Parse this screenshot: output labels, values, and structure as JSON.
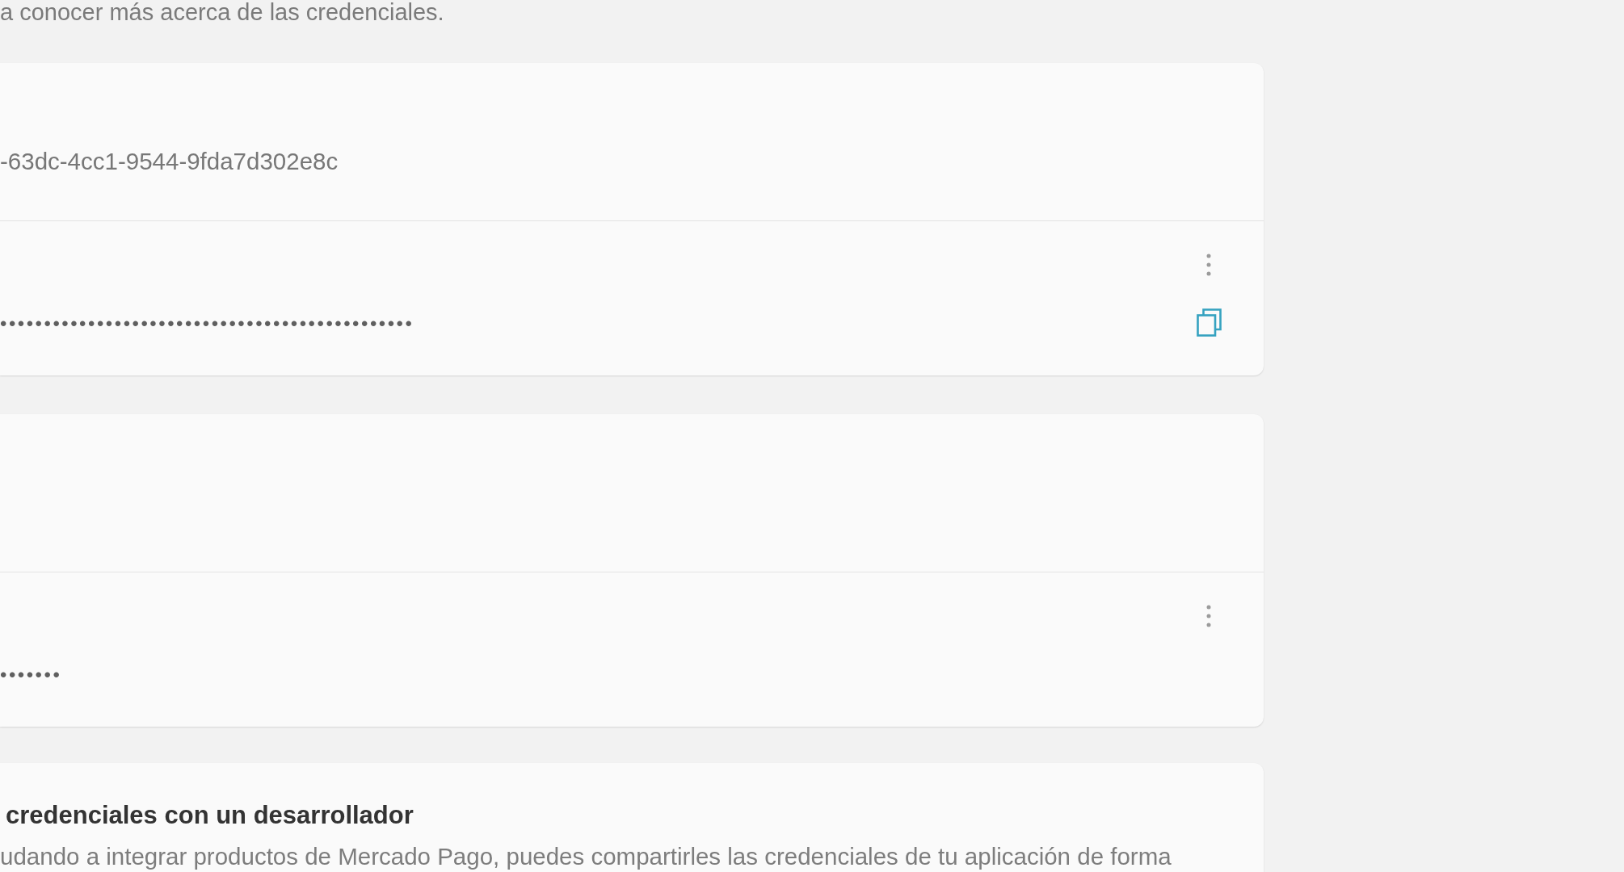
{
  "intro": "a conocer más acerca de las credenciales.",
  "credential_cards": [
    {
      "sections": [
        {
          "kind": "value",
          "value": "-63dc-4cc1-9544-9fda7d302e8c"
        },
        {
          "kind": "secret",
          "masked_value": "•••••••••••••••••••••••••••••••••••••••••••••••",
          "copy_button": true
        }
      ]
    },
    {
      "sections": [
        {
          "kind": "blank"
        },
        {
          "kind": "secret",
          "masked_value": "•••••••",
          "copy_button": false
        }
      ]
    }
  ],
  "share_card": {
    "title": "credenciales con un desarrollador",
    "description": "udando a integrar productos de Mercado Pago, puedes compartirles las credenciales de tu aplicación de forma"
  }
}
